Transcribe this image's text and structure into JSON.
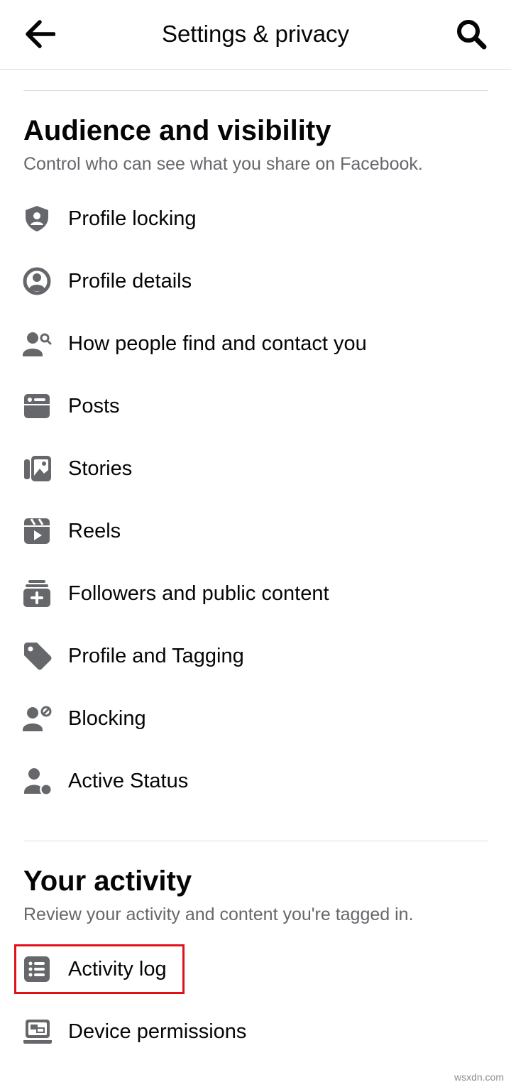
{
  "header": {
    "title": "Settings & privacy",
    "back_icon": "arrow-left-icon",
    "search_icon": "search-icon"
  },
  "audience_section": {
    "title": "Audience and visibility",
    "subtitle": "Control who can see what you share on Facebook.",
    "items": [
      {
        "label": "Profile locking",
        "icon": "shield-person-icon"
      },
      {
        "label": "Profile details",
        "icon": "profile-circle-icon"
      },
      {
        "label": "How people find and contact you",
        "icon": "person-search-icon"
      },
      {
        "label": "Posts",
        "icon": "posts-icon"
      },
      {
        "label": "Stories",
        "icon": "stories-icon"
      },
      {
        "label": "Reels",
        "icon": "reels-icon"
      },
      {
        "label": "Followers and public content",
        "icon": "add-feed-icon"
      },
      {
        "label": "Profile and Tagging",
        "icon": "tag-icon"
      },
      {
        "label": "Blocking",
        "icon": "person-block-icon"
      },
      {
        "label": "Active Status",
        "icon": "person-active-icon"
      }
    ]
  },
  "activity_section": {
    "title": "Your activity",
    "subtitle": "Review your activity and content you're tagged in.",
    "items": [
      {
        "label": "Activity log",
        "icon": "list-icon",
        "highlighted": true
      },
      {
        "label": "Device permissions",
        "icon": "device-icon"
      }
    ]
  },
  "colors": {
    "text_primary": "#050505",
    "text_secondary": "#65676b",
    "icon": "#65676b",
    "divider": "#dadde1",
    "highlight": "#e0111b"
  },
  "watermark": "wsxdn.com"
}
